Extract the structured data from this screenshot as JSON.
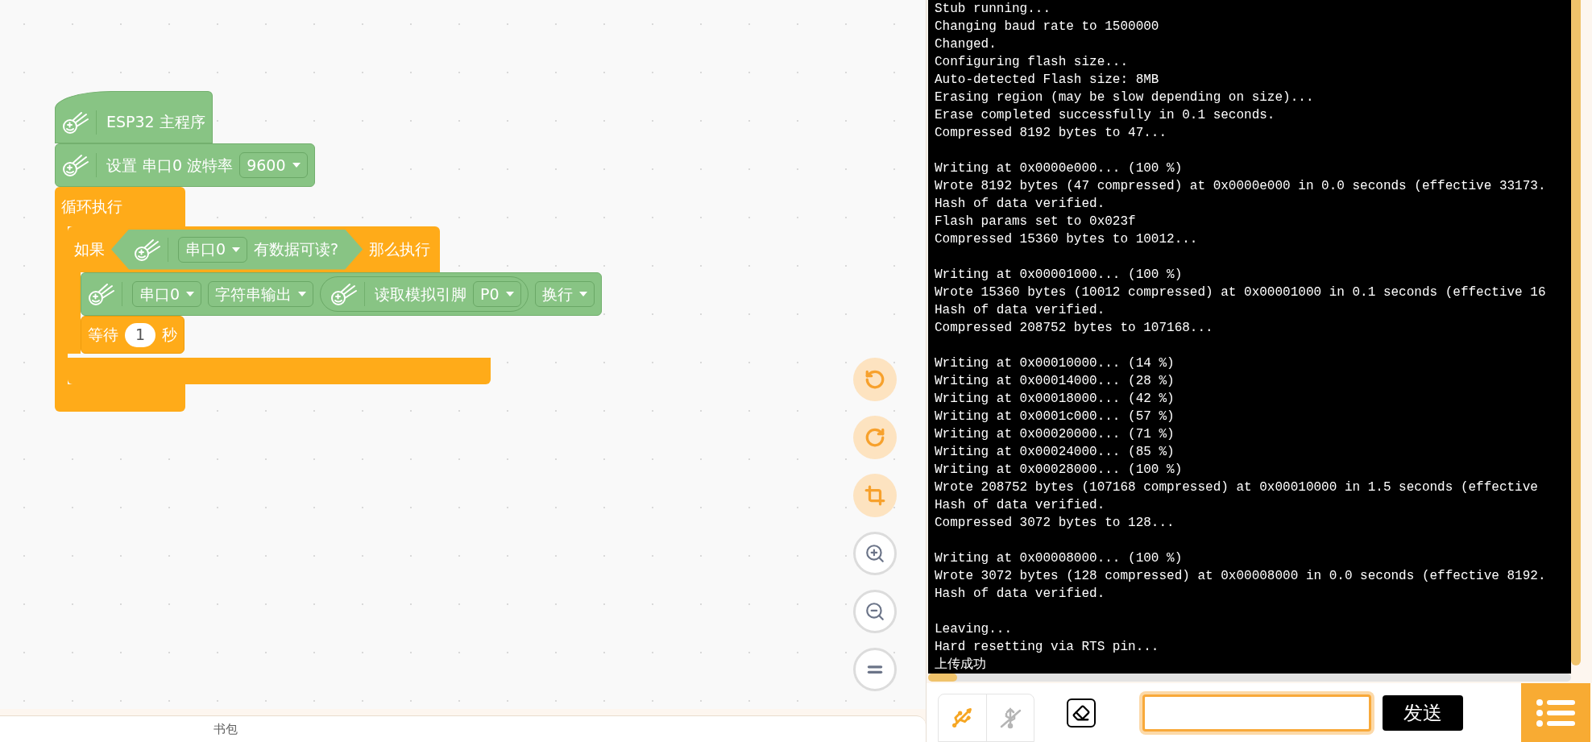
{
  "workspace": {
    "blocks": [
      {
        "kind": "hat",
        "parts": [
          {
            "kind": "icon"
          },
          {
            "kind": "text",
            "text": "ESP32 主程序"
          }
        ]
      },
      {
        "kind": "statement",
        "parts": [
          {
            "kind": "icon"
          },
          {
            "kind": "text",
            "text": "设置 串口0 波特率"
          },
          {
            "kind": "dropdown",
            "text": "9600"
          }
        ]
      },
      {
        "kind": "loop",
        "label": "循环执行",
        "children": [
          {
            "kind": "if",
            "parts": [
              {
                "kind": "text",
                "text": "如果"
              },
              {
                "kind": "boolean",
                "parts": [
                  {
                    "kind": "icon"
                  },
                  {
                    "kind": "dropdown",
                    "text": "串口0"
                  },
                  {
                    "kind": "text",
                    "text": "有数据可读?"
                  }
                ]
              },
              {
                "kind": "text",
                "text": "那么执行"
              }
            ],
            "children": [
              {
                "kind": "statement",
                "parts": [
                  {
                    "kind": "icon"
                  },
                  {
                    "kind": "dropdown",
                    "text": "串口0"
                  },
                  {
                    "kind": "dropdown",
                    "text": "字符串输出"
                  },
                  {
                    "kind": "reporter",
                    "parts": [
                      {
                        "kind": "icon"
                      },
                      {
                        "kind": "text",
                        "text": "读取模拟引脚"
                      },
                      {
                        "kind": "dropdown",
                        "text": "P0"
                      }
                    ]
                  },
                  {
                    "kind": "dropdown",
                    "text": "换行"
                  }
                ]
              },
              {
                "kind": "wait",
                "parts": [
                  {
                    "kind": "text",
                    "text": "等待"
                  },
                  {
                    "kind": "number",
                    "text": "1"
                  },
                  {
                    "kind": "text",
                    "text": "秒"
                  }
                ]
              }
            ]
          }
        ]
      }
    ]
  },
  "bottom_tab": "书包",
  "console": {
    "groups": [
      [
        "Stub running...",
        "Changing baud rate to 1500000",
        "Changed.",
        "Configuring flash size...",
        "Auto-detected Flash size: 8MB",
        "Erasing region (may be slow depending on size)...",
        "Erase completed successfully in 0.1 seconds.",
        "Compressed 8192 bytes to 47..."
      ],
      [
        "Writing at 0x0000e000... (100 %)",
        "Wrote 8192 bytes (47 compressed) at 0x0000e000 in 0.0 seconds (effective 33173.",
        "Hash of data verified.",
        "Flash params set to 0x023f",
        "Compressed 15360 bytes to 10012..."
      ],
      [
        "Writing at 0x00001000... (100 %)",
        "Wrote 15360 bytes (10012 compressed) at 0x00001000 in 0.1 seconds (effective 16",
        "Hash of data verified.",
        "Compressed 208752 bytes to 107168..."
      ],
      [
        "Writing at 0x00010000... (14 %)",
        "Writing at 0x00014000... (28 %)",
        "Writing at 0x00018000... (42 %)",
        "Writing at 0x0001c000... (57 %)",
        "Writing at 0x00020000... (71 %)",
        "Writing at 0x00024000... (85 %)",
        "Writing at 0x00028000... (100 %)",
        "Wrote 208752 bytes (107168 compressed) at 0x00010000 in 1.5 seconds (effective",
        "Hash of data verified.",
        "Compressed 3072 bytes to 128..."
      ],
      [
        "Writing at 0x00008000... (100 %)",
        "Wrote 3072 bytes (128 compressed) at 0x00008000 in 0.0 seconds (effective 8192.",
        "Hash of data verified."
      ],
      [
        "Leaving...",
        "Hard resetting via RTS pin...",
        "上传成功"
      ]
    ]
  },
  "send_button": "发送"
}
